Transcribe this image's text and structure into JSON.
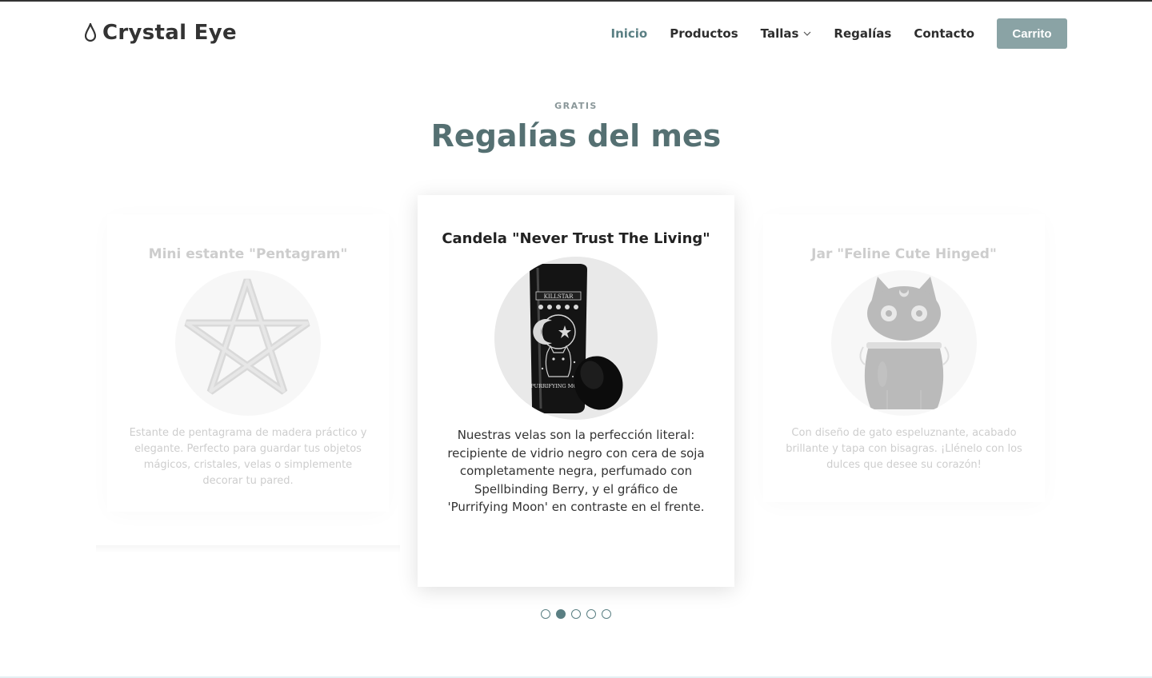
{
  "brand": {
    "name": "Crystal Eye",
    "icon": "drop-icon"
  },
  "nav": {
    "items": [
      {
        "label": "Inicio",
        "active": true
      },
      {
        "label": "Productos",
        "active": false
      },
      {
        "label": "Tallas",
        "active": false,
        "dropdown": true
      },
      {
        "label": "Regalías",
        "active": false
      },
      {
        "label": "Contacto",
        "active": false
      }
    ],
    "cart_label": "Carrito"
  },
  "section": {
    "eyebrow": "GRATIS",
    "title": "Regalías del mes"
  },
  "carousel": {
    "cards": [
      {
        "title": "Mini estante \"Pentagram\"",
        "image": "pentagram-shelf-image",
        "description": "Estante de pentagrama de madera práctico y elegante. Perfecto para guardar tus objetos mágicos, cristales, velas o simplemente decorar tu pared."
      },
      {
        "title": "Candela \"Never Trust The Living\"",
        "image": "candle-jar-image",
        "description": "Nuestras velas son la perfección literal: recipiente de vidrio negro con cera de soja completamente negra, perfumado con Spellbinding Berry, y el gráfico de 'Purrifying Moon' en contraste en el frente."
      },
      {
        "title": "Jar \"Feline Cute Hinged\"",
        "image": "cat-jar-image",
        "description": "Con diseño de gato espeluznante, acabado brillante y tapa con bisagras. ¡Llénelo con los dulces que desee su corazón!"
      }
    ],
    "active_index": 1,
    "dot_count": 5,
    "candle_label_top": "KILLSTAR",
    "candle_label_bottom": "PURRIFYING MOON"
  },
  "colors": {
    "accent": "#5a7f83",
    "button": "#8aa3a5",
    "title": "#557072"
  }
}
